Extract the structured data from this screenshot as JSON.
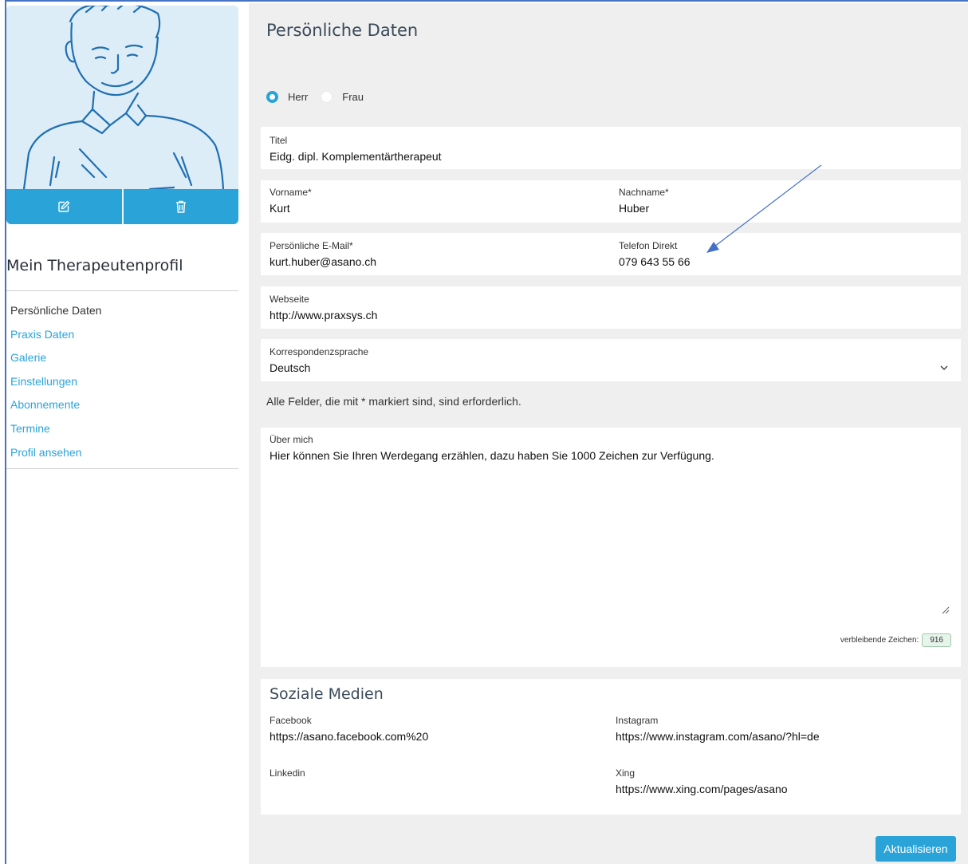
{
  "sidebar": {
    "title": "Mein Therapeutenprofil",
    "items": [
      {
        "label": "Persönliche Daten",
        "active": true
      },
      {
        "label": "Praxis Daten"
      },
      {
        "label": "Galerie"
      },
      {
        "label": "Einstellungen"
      },
      {
        "label": "Abonnemente"
      },
      {
        "label": "Termine"
      },
      {
        "label": "Profil ansehen"
      }
    ]
  },
  "page": {
    "title": "Persönliche Daten",
    "salutation": {
      "options": [
        "Herr",
        "Frau"
      ],
      "selected": "Herr"
    },
    "titel": {
      "label": "Titel",
      "value": "Eidg. dipl. Komplementärtherapeut"
    },
    "vorname": {
      "label": "Vorname*",
      "value": "Kurt"
    },
    "nachname": {
      "label": "Nachname*",
      "value": "Huber"
    },
    "email": {
      "label": "Persönliche E-Mail*",
      "value": "kurt.huber@asano.ch"
    },
    "telefon": {
      "label": "Telefon Direkt",
      "value": "079 643 55 66"
    },
    "webseite": {
      "label": "Webseite",
      "value": "http://www.praxsys.ch"
    },
    "sprache": {
      "label": "Korrespondenzsprache",
      "value": "Deutsch"
    },
    "required_hint": "Alle Felder, die mit * markiert sind, sind erforderlich.",
    "about": {
      "label": "Über mich",
      "value": "Hier können Sie Ihren Werdegang erzählen, dazu haben Sie 1000 Zeichen zur Verfügung.",
      "counter_label": "verbleibende Zeichen:",
      "counter_value": "916"
    },
    "social": {
      "title": "Soziale Medien",
      "facebook": {
        "label": "Facebook",
        "value": "https://asano.facebook.com%20"
      },
      "instagram": {
        "label": "Instagram",
        "value": "https://www.instagram.com/asano/?hl=de"
      },
      "linkedin": {
        "label": "Linkedin",
        "value": ""
      },
      "xing": {
        "label": "Xing",
        "value": "https://www.xing.com/pages/asano"
      }
    },
    "submit_label": "Aktualisieren"
  },
  "colors": {
    "accent": "#2aa3d9",
    "annotation": "#4472c4",
    "panel_bg": "#efefef"
  }
}
